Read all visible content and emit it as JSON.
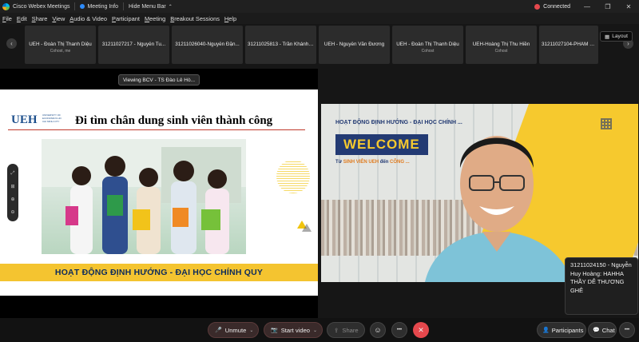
{
  "app": {
    "title": "Cisco Webex Meetings"
  },
  "titlebar": {
    "meeting_info": "Meeting Info",
    "hide_menu": "Hide Menu Bar",
    "hide_menu_caret": "⌃",
    "status": "Connected",
    "minimize": "—",
    "restore": "❐",
    "close": "✕"
  },
  "menu": [
    {
      "label": "File",
      "key": "F",
      "rest": "ile"
    },
    {
      "label": "Edit",
      "key": "E",
      "rest": "dit"
    },
    {
      "label": "Share",
      "key": "S",
      "rest": "hare"
    },
    {
      "label": "View",
      "key": "V",
      "rest": "iew"
    },
    {
      "label": "Audio & Video",
      "key": "A",
      "rest": "udio & Video"
    },
    {
      "label": "Participant",
      "key": "P",
      "rest": "articipant"
    },
    {
      "label": "Meeting",
      "key": "M",
      "rest": "eeting"
    },
    {
      "label": "Breakout Sessions",
      "key": "B",
      "rest": "reakout Sessions"
    },
    {
      "label": "Help",
      "key": "H",
      "rest": "elp"
    }
  ],
  "strip": {
    "prev": "‹",
    "next": "›",
    "tiles": [
      {
        "name": "UEH - Đoàn Thị Thanh Diệu",
        "role": "Cohost, me"
      },
      {
        "name": "31211027217 - Nguyễn Tu...",
        "role": ""
      },
      {
        "name": "31211026040-Nguyễn Đặn...",
        "role": ""
      },
      {
        "name": "31211025813 - Trần Khánh ...",
        "role": ""
      },
      {
        "name": "UEH - Nguyễn Văn Đương",
        "role": ""
      },
      {
        "name": "UEH - Đoàn Thị Thanh Diệu",
        "role": "Cohost"
      },
      {
        "name": "UEH-Hoàng Thị Thu Hiền",
        "role": "Cohost"
      },
      {
        "name": "31211027104-PHAM THI N...",
        "role": ""
      }
    ],
    "layout_label": "Layout",
    "layout_icon": "▦"
  },
  "share": {
    "viewing": "Viewing BCV - TS Đào Lê Hò...",
    "slide": {
      "logo": "UEH",
      "logo_sub": "UNIVERSITY OF ECONOMICS HO CHI MINH CITY",
      "title": "Đi tìm chân dung sinh viên thành công",
      "band": "HOẠT ĐỘNG ĐỊNH HƯỚNG - ĐẠI HỌC CHÍNH QUY"
    },
    "zoom_tools": [
      "⤢",
      "⊞",
      "⊕",
      "⊖"
    ]
  },
  "speaker": {
    "tag": "HOẠT ĐỘNG ĐỊNH HƯỚNG - ĐẠI HỌC CHÍNH ...",
    "welcome": "WELCOME",
    "sub_prefix": "Từ ",
    "sub_highlight": "SINH VIÊN UEH",
    "sub_mid": " đến ",
    "sub_end": "CÔNG ..."
  },
  "chat_popup": {
    "text": "31211024150 - Nguyễn Huy Hoàng: HAHHA THẦY DỄ THƯƠNG GHÊ"
  },
  "controls": {
    "unmute": "Unmute",
    "mic_icon": "🎤",
    "start_video": "Start video",
    "video_icon": "📷",
    "share": "Share",
    "share_icon": "⇪",
    "caret": "⌄",
    "reactions_icon": "☺",
    "more_icon": "•••",
    "end_icon": "✕",
    "participants": "Participants",
    "participants_icon": "👤",
    "chat": "Chat",
    "chat_icon": "💬"
  },
  "colors": {
    "accent": "#2d8cff",
    "danger": "#e5484d",
    "slide_band": "#f4c430",
    "navy": "#233a73"
  }
}
